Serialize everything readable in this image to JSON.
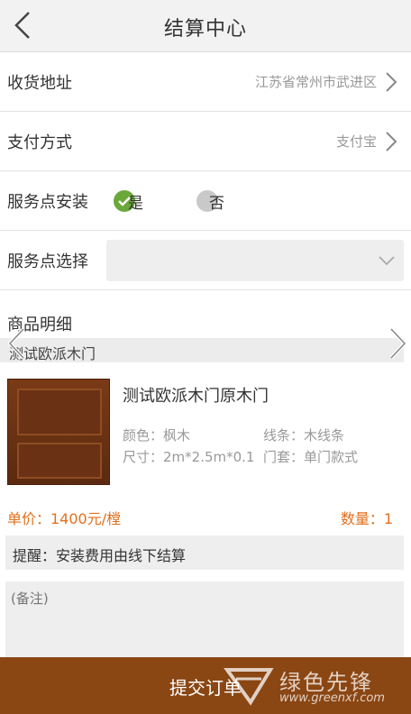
{
  "header": {
    "title": "结算中心",
    "back_icon": "chevron-left-icon"
  },
  "address": {
    "label": "收货地址",
    "value": "江苏省常州市武进区"
  },
  "payment": {
    "label": "支付方式",
    "value": "支付宝"
  },
  "install": {
    "label": "服务点安装",
    "options": [
      {
        "label": "是",
        "selected": true
      },
      {
        "label": "否",
        "selected": false
      }
    ],
    "accent_color": "#6aa83a"
  },
  "service_point": {
    "label": "服务点选择",
    "selected": ""
  },
  "products": {
    "section_label": "商品明细",
    "strip_label": "测试欧派木门",
    "item": {
      "name": "测试欧派木门原木门",
      "color": "颜色：枫木",
      "lines": "线条：木线条",
      "size": "尺寸：2m*2.5m*0.1",
      "cover": "门套：单门款式",
      "price": "单价：1400元/樘",
      "quantity": "数量：1"
    }
  },
  "reminder": "提醒：安装费用由线下结算",
  "notes": {
    "placeholder": "(备注)"
  },
  "footer": {
    "submit_label": "提交订单",
    "bg_color": "#8a4613"
  },
  "watermark": {
    "text": "绿色先锋",
    "url": "www.greenxf.com"
  }
}
